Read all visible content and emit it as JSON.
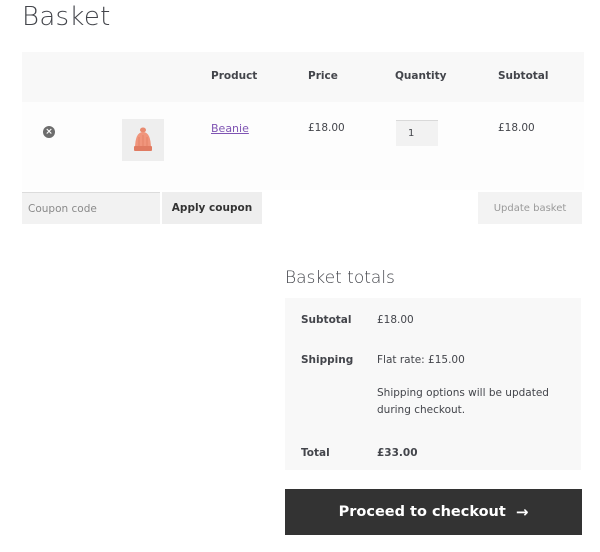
{
  "page": {
    "title": "Basket"
  },
  "cart": {
    "headers": {
      "product": "Product",
      "price": "Price",
      "quantity": "Quantity",
      "subtotal": "Subtotal"
    },
    "items": [
      {
        "name": "Beanie",
        "price": "£18.00",
        "quantity": "1",
        "subtotal": "£18.00",
        "remove_icon": "×"
      }
    ]
  },
  "coupon": {
    "placeholder": "Coupon code",
    "apply_label": "Apply coupon"
  },
  "update_label": "Update basket",
  "totals": {
    "title": "Basket totals",
    "subtotal_label": "Subtotal",
    "subtotal_value": "£18.00",
    "shipping_label": "Shipping",
    "shipping_value": "Flat rate: £15.00",
    "shipping_note": "Shipping options will be updated during checkout.",
    "total_label": "Total",
    "total_value": "£33.00"
  },
  "checkout": {
    "label": "Proceed to checkout",
    "icon": "→"
  },
  "colors": {
    "link": "#7f54b3",
    "button_dark": "#333333",
    "text": "#43454b"
  }
}
